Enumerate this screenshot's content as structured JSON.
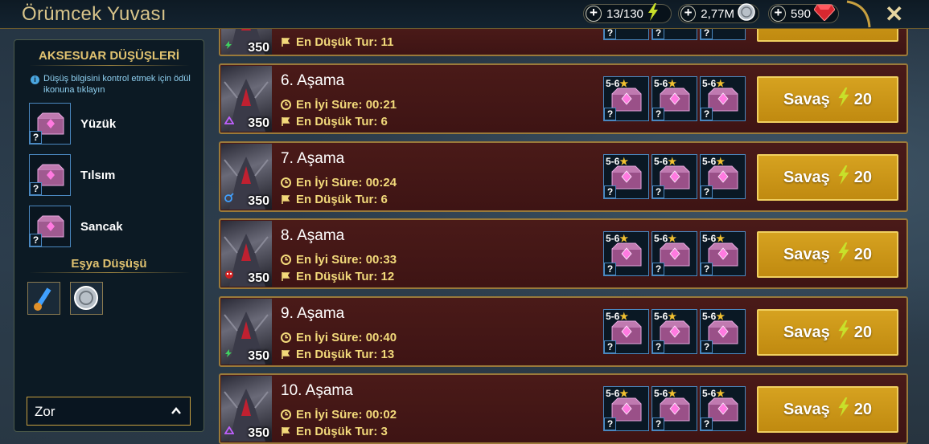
{
  "header": {
    "title": "Örümcek Yuvası",
    "energy": "13/130",
    "silver": "2,77M",
    "gems": "590"
  },
  "left_panel": {
    "accessory_title": "AKSESUAR DÜŞÜŞLERİ",
    "info": "Düşüş bilgisini kontrol etmek için ödül ikonuna tıklayın",
    "accessories": [
      "Yüzük",
      "Tılsım",
      "Sancak"
    ],
    "item_drop_title": "Eşya Düşüşü",
    "difficulty": "Zor"
  },
  "partial_row": {
    "level": "350",
    "turn_label": "En Düşük Tur: 11"
  },
  "stages": [
    {
      "title": "6. Aşama",
      "time": "En İyi Süre: 00:21",
      "turns": "En Düşük Tur: 6",
      "level": "350",
      "affinity": "void"
    },
    {
      "title": "7. Aşama",
      "time": "En İyi Süre: 00:24",
      "turns": "En Düşük Tur: 6",
      "level": "350",
      "affinity": "magic"
    },
    {
      "title": "8. Aşama",
      "time": "En İyi Süre: 00:33",
      "turns": "En Düşük Tur: 12",
      "level": "350",
      "affinity": "force"
    },
    {
      "title": "9. Aşama",
      "time": "En İyi Süre: 00:40",
      "turns": "En Düşük Tur: 13",
      "level": "350",
      "affinity": "spirit"
    },
    {
      "title": "10. Aşama",
      "time": "En İyi Süre: 00:02",
      "turns": "En Düşük Tur: 3",
      "level": "350",
      "affinity": "void"
    }
  ],
  "reward": {
    "stars": "5-6",
    "question": "?"
  },
  "battle": {
    "label": "Savaş",
    "cost": "20"
  },
  "colors": {
    "gold": "#d6a220",
    "row": "#4a1a18",
    "border": "#9a7a3a",
    "accent": "#e0c270"
  }
}
